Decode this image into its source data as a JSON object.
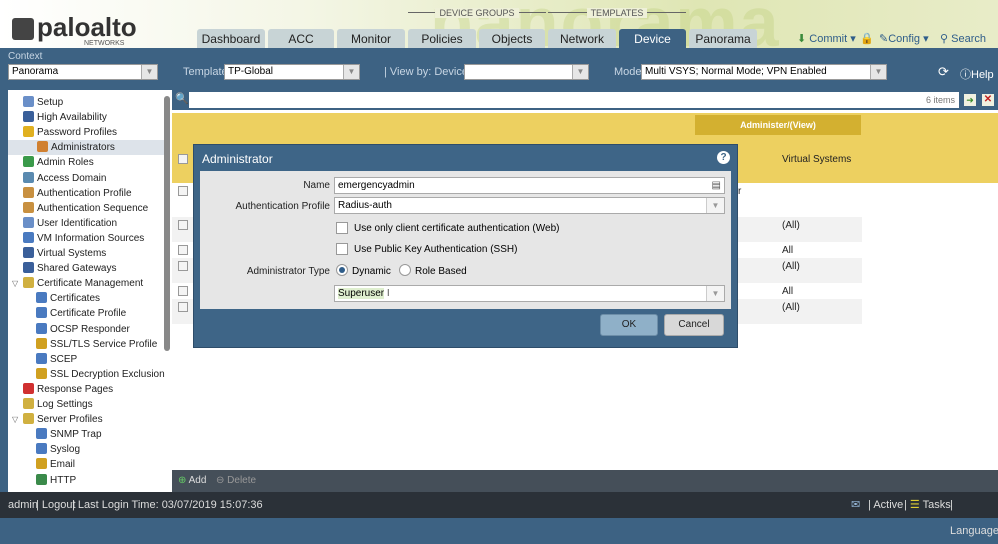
{
  "header": {
    "brand": "paloalto",
    "brand_sub": "NETWORKS",
    "watermark": "panorama",
    "groups": [
      "DEVICE GROUPS",
      "TEMPLATES"
    ],
    "tabs": [
      "Dashboard",
      "ACC",
      "Monitor",
      "Policies",
      "Objects",
      "Network",
      "Device",
      "Panorama"
    ],
    "active_tab": "Device",
    "commit": "Commit",
    "config": "Config",
    "search": "Search"
  },
  "context": {
    "label": "Context",
    "value": "Panorama",
    "template_label": "Template",
    "template_value": "TP-Global",
    "viewby_label": "View by:",
    "viewby_type": "Device",
    "viewby_value": "",
    "mode_label": "Mode",
    "mode_value": "Multi VSYS; Normal Mode; VPN Enabled",
    "help": "Help"
  },
  "sidebar": {
    "items": [
      {
        "label": "Setup",
        "color": "#6a8fc8"
      },
      {
        "label": "High Availability",
        "color": "#3a5f9a"
      },
      {
        "label": "Password Profiles",
        "color": "#e0b020"
      },
      {
        "label": "Administrators",
        "color": "#d08030"
      },
      {
        "label": "Admin Roles",
        "color": "#3a9a4a"
      },
      {
        "label": "Access Domain",
        "color": "#5a8ab0"
      },
      {
        "label": "Authentication Profile",
        "color": "#c89040"
      },
      {
        "label": "Authentication Sequence",
        "color": "#c89040"
      },
      {
        "label": "User Identification",
        "color": "#6a8fc8"
      },
      {
        "label": "VM Information Sources",
        "color": "#4a7ac0"
      },
      {
        "label": "Virtual Systems",
        "color": "#3a5f9a"
      },
      {
        "label": "Shared Gateways",
        "color": "#3a5f9a"
      },
      {
        "label": "Certificate Management",
        "color": "#d0b040"
      },
      {
        "label": "Certificates",
        "color": "#4a7ac0"
      },
      {
        "label": "Certificate Profile",
        "color": "#4a7ac0"
      },
      {
        "label": "OCSP Responder",
        "color": "#4a7ac0"
      },
      {
        "label": "SSL/TLS Service Profile",
        "color": "#d0a020"
      },
      {
        "label": "SCEP",
        "color": "#4a7ac0"
      },
      {
        "label": "SSL Decryption Exclusion",
        "color": "#d0a020"
      },
      {
        "label": "Response Pages",
        "color": "#d03030"
      },
      {
        "label": "Log Settings",
        "color": "#d0b040"
      },
      {
        "label": "Server Profiles",
        "color": "#d0b040"
      },
      {
        "label": "SNMP Trap",
        "color": "#4a7ac0"
      },
      {
        "label": "Syslog",
        "color": "#4a7ac0"
      },
      {
        "label": "Email",
        "color": "#d0a020"
      },
      {
        "label": "HTTP",
        "color": "#3a8a4a"
      }
    ]
  },
  "grid": {
    "items_count": "6 items",
    "group_header": "Administer/(View)",
    "col_vsys": "Virtual Systems",
    "row_fragment": "r",
    "rows": [
      "",
      "(All)",
      "All",
      "(All)",
      "All",
      "(All)"
    ]
  },
  "toolbar": {
    "add": "Add",
    "delete": "Delete"
  },
  "footer": {
    "user": "admin",
    "logout": "Logout",
    "last_login": "Last Login Time: 03/07/2019 15:07:36",
    "active": "Active",
    "tasks": "Tasks",
    "language": "Language"
  },
  "modal": {
    "title": "Administrator",
    "name_label": "Name",
    "name_value": "emergencyadmin",
    "auth_label": "Authentication Profile",
    "auth_value": "Radius-auth",
    "cert_cb": "Use only client certificate authentication (Web)",
    "pubkey_cb": "Use Public Key Authentication (SSH)",
    "type_label": "Administrator Type",
    "opt_dynamic": "Dynamic",
    "opt_role": "Role Based",
    "role_value": "Superuser",
    "ok": "OK",
    "cancel": "Cancel"
  }
}
